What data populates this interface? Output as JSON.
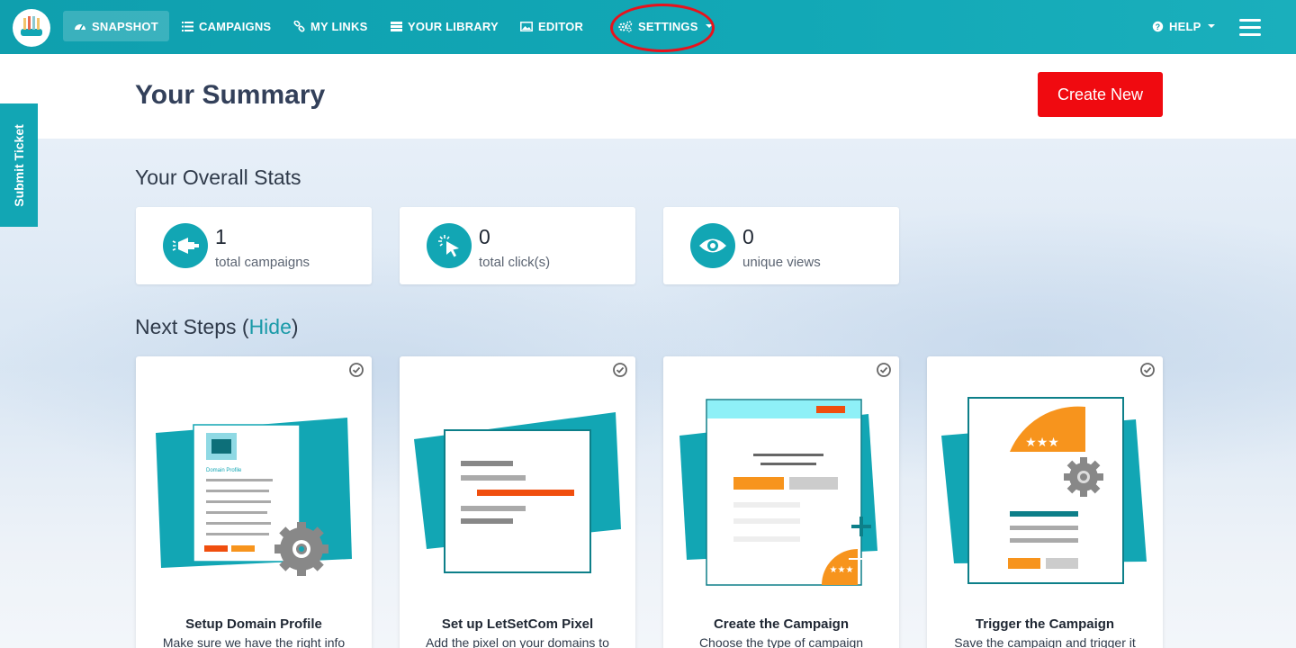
{
  "nav": {
    "items": [
      {
        "label": "SNAPSHOT",
        "icon": "dashboard-icon"
      },
      {
        "label": "CAMPAIGNS",
        "icon": "list-icon"
      },
      {
        "label": "MY LINKS",
        "icon": "link-icon"
      },
      {
        "label": "YOUR LIBRARY",
        "icon": "library-icon"
      },
      {
        "label": "EDITOR",
        "icon": "image-icon"
      },
      {
        "label": "SETTINGS",
        "icon": "gears-icon"
      }
    ],
    "help_label": "HELP"
  },
  "summary": {
    "title": "Your Summary",
    "create_label": "Create New"
  },
  "submit_ticket_label": "Submit Ticket",
  "stats": {
    "title": "Your Overall Stats",
    "items": [
      {
        "value": "1",
        "label": "total campaigns",
        "icon": "megaphone-icon"
      },
      {
        "value": "0",
        "label": "total click(s)",
        "icon": "cursor-click-icon"
      },
      {
        "value": "0",
        "label": "unique views",
        "icon": "eye-icon"
      }
    ]
  },
  "next_steps": {
    "title": "Next Steps",
    "hide_open": "(",
    "hide_label": "Hide",
    "hide_close": ")",
    "items": [
      {
        "title": "Setup Domain Profile",
        "desc": "Make sure we have the right info",
        "illus_label": "Domain Profile"
      },
      {
        "title": "Set up LetSetCom Pixel",
        "desc": "Add the pixel on your domains to"
      },
      {
        "title": "Create the Campaign",
        "desc": "Choose the type of campaign"
      },
      {
        "title": "Trigger the Campaign",
        "desc": "Save the campaign and trigger it"
      }
    ]
  },
  "colors": {
    "teal": "#12a6b4",
    "accent_red": "#f00a10",
    "orange": "#f7941d",
    "annotation": "#e8121c"
  }
}
